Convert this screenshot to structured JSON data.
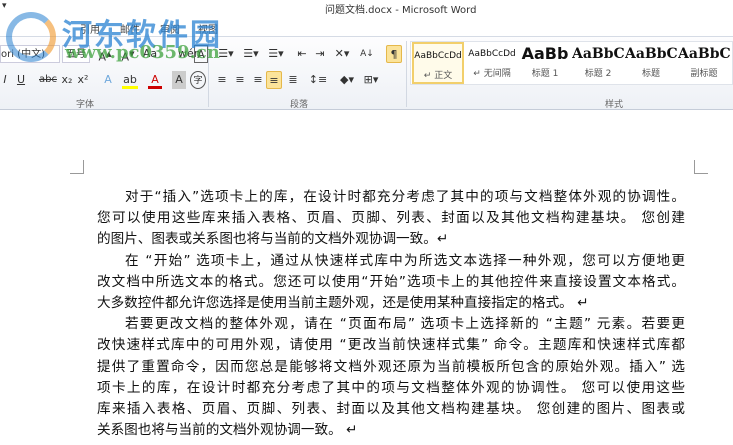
{
  "window": {
    "title": "问题文档.docx - Microsoft Word",
    "quick_access": "▾"
  },
  "tabs": [
    "引用",
    "邮件",
    "审阅",
    "视图"
  ],
  "font": {
    "name": "ori (中文)",
    "size": "五号",
    "group_label": "字体"
  },
  "paragraph": {
    "group_label": "段落"
  },
  "styles": {
    "group_label": "样式",
    "items": [
      {
        "preview": "AaBbCcDd",
        "name": "↵ 正文",
        "active": true
      },
      {
        "preview": "AaBbCcDd",
        "name": "↵ 无间隔"
      },
      {
        "preview": "AaBb",
        "name": "标题 1"
      },
      {
        "preview": "AaBbC",
        "name": "标题 2"
      },
      {
        "preview": "AaBbC",
        "name": "标题"
      },
      {
        "preview": "AaBbC",
        "name": "副标题"
      }
    ]
  },
  "watermark": {
    "name": "河东软件园",
    "url": "www.pc0359.cn"
  },
  "document": {
    "lines": [
      {
        "t": "对于“插入”选项卡上的库，在设计时都充分考虑了其中的项与文档整体外观的协调性。",
        "ind": true
      },
      {
        "t": "您可以使用这些库来插入表格、页眉、页脚、列表、封面以及其他文档构建基块。 您创建"
      },
      {
        "t": "的图片、图表或关系图也将与当前的文档外观协调一致。↵",
        "last": true
      },
      {
        "t": "在 “开始” 选项卡上，通过从快速样式库中为所选文本选择一种外观，您可以方便地更",
        "ind": true
      },
      {
        "t": "改文档中所选文本的格式。您还可以使用“开始”选项卡上的其他控件来直接设置文本格式。"
      },
      {
        "t": "大多数控件都允许您选择是使用当前主题外观，还是使用某种直接指定的格式。 ↵",
        "last": true
      },
      {
        "t": "若要更改文档的整体外观，请在 “页面布局” 选项卡上选择新的 “主题” 元素。若要更",
        "ind": true
      },
      {
        "t": "改快速样式库中的可用外观，请使用 “更改当前快速样式集” 命令。主题库和快速样式库都"
      },
      {
        "t": "提供了重置命令，因而您总是能够将文档外观还原为当前模板所包含的原始外观。插入” 选"
      },
      {
        "t": "项卡上的库，在设计时都充分考虑了其中的项与文档整体外观的协调性。 您可以使用这些"
      },
      {
        "t": "库来插入表格、页眉、页脚、列表、封面以及其他文档构建基块。 您创建的图片、图表或"
      },
      {
        "t": "关系图也将与当前的文档外观协调一致。 ↵",
        "last": true
      }
    ]
  }
}
